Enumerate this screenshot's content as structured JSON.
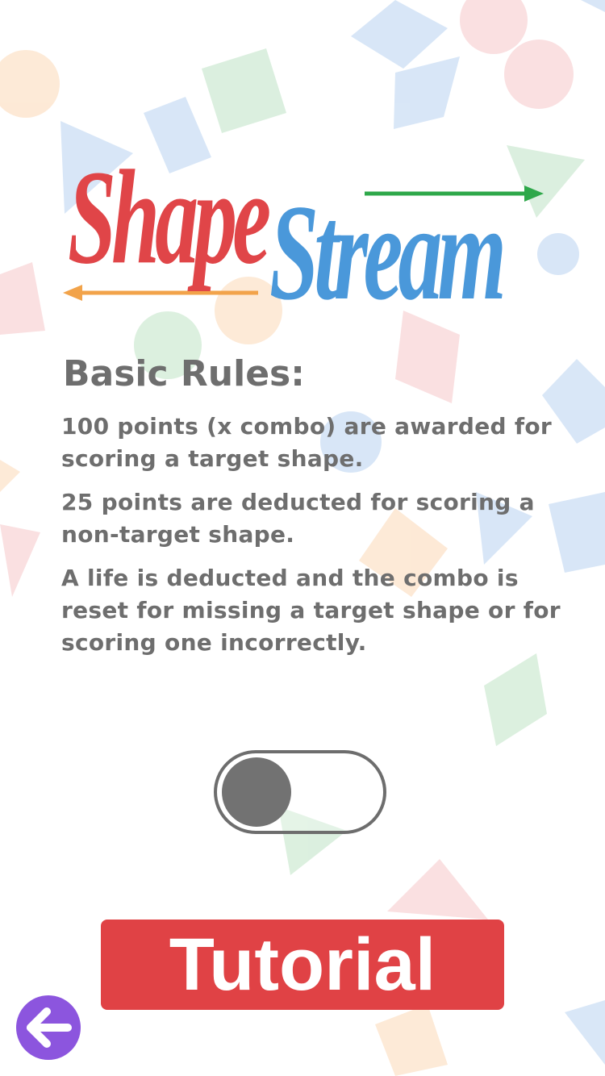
{
  "app": {
    "logo_part1": "Shape",
    "logo_part2": "Stream",
    "colors": {
      "logo_red": "#e04548",
      "logo_blue": "#4a98da",
      "arrow_green": "#2ea84a",
      "arrow_orange": "#f2a34a",
      "text_gray": "#6e6e6e",
      "button_red": "#e04245",
      "back_purple": "#8c55de"
    }
  },
  "rules": {
    "title": "Basic Rules:",
    "items": [
      "100 points (x combo) are awarded for scoring a target shape.",
      "25 points are deducted for scoring a non-target shape.",
      "A life is deducted and the combo is reset for missing a target shape or for scoring one incorrectly."
    ]
  },
  "toggle": {
    "on": false
  },
  "tutorial_button": {
    "label": "Tutorial"
  },
  "back_button": {
    "icon": "back-arrow-icon"
  }
}
